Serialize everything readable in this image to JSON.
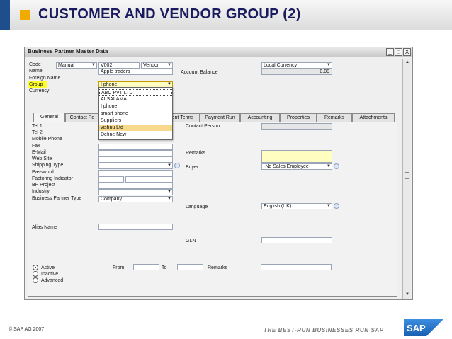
{
  "slide": {
    "title": "CUSTOMER AND VENDOR GROUP (2)",
    "copyright": "© SAP AG 2007",
    "tagline": "THE BEST-RUN BUSINESSES RUN SAP",
    "logo_text": "SAP"
  },
  "window": {
    "title": "Business Partner Master Data",
    "btn_min": "_",
    "btn_max": "□",
    "btn_close": "X"
  },
  "header": {
    "code_label": "Code",
    "code_mode": "Manual",
    "code_value": "V002",
    "type_value": "Vendor",
    "currency_type": "Local Currency",
    "name_label": "Name",
    "name_value": "Apple traders",
    "balance_label": "Account Balance",
    "balance_value": "0.00",
    "foreign_name_label": "Foreign Name",
    "group_label": "Group",
    "group_value": "I phone",
    "currency_label": "Currency"
  },
  "group_dropdown": {
    "options": [
      "ABC PVT LTD",
      "ALSALAMA",
      "I phone",
      "smart phone",
      "Suppliers",
      "vishnu Ltd",
      "Define New"
    ],
    "selected": "vishnu Ltd"
  },
  "tabs": [
    "General",
    "Contact Pe",
    "nent Terms",
    "Payment Run",
    "Accounting",
    "Properties",
    "Remarks",
    "Attachments"
  ],
  "general": {
    "tel1": "Tel 1",
    "tel2": "Tel 2",
    "mobile": "Mobile Phone",
    "fax": "Fax",
    "email": "E-Mail",
    "website": "Web Site",
    "shipping": "Shipping Type",
    "password": "Password",
    "factoring": "Factoring Indicator",
    "bp_project": "BP Project",
    "industry": "Industry",
    "bp_type": "Business Partner Type",
    "bp_type_value": "Company",
    "alias": "Alias Name",
    "contact_person": "Contact Person",
    "remarks": "Remarks",
    "buyer": "Buyer",
    "buyer_value": "-No Sales Employee-",
    "language": "Language",
    "language_value": "English (UK)",
    "gln": "GLN",
    "status_active": "Active",
    "status_inactive": "Inactive",
    "status_advanced": "Advanced",
    "from": "From",
    "to": "To",
    "remarks2": "Remarks"
  },
  "colors": {
    "title": "#1a1a5e",
    "accent": "#f0ab00",
    "highlight": "#ffff2a",
    "blue": "#1f4e8c"
  }
}
